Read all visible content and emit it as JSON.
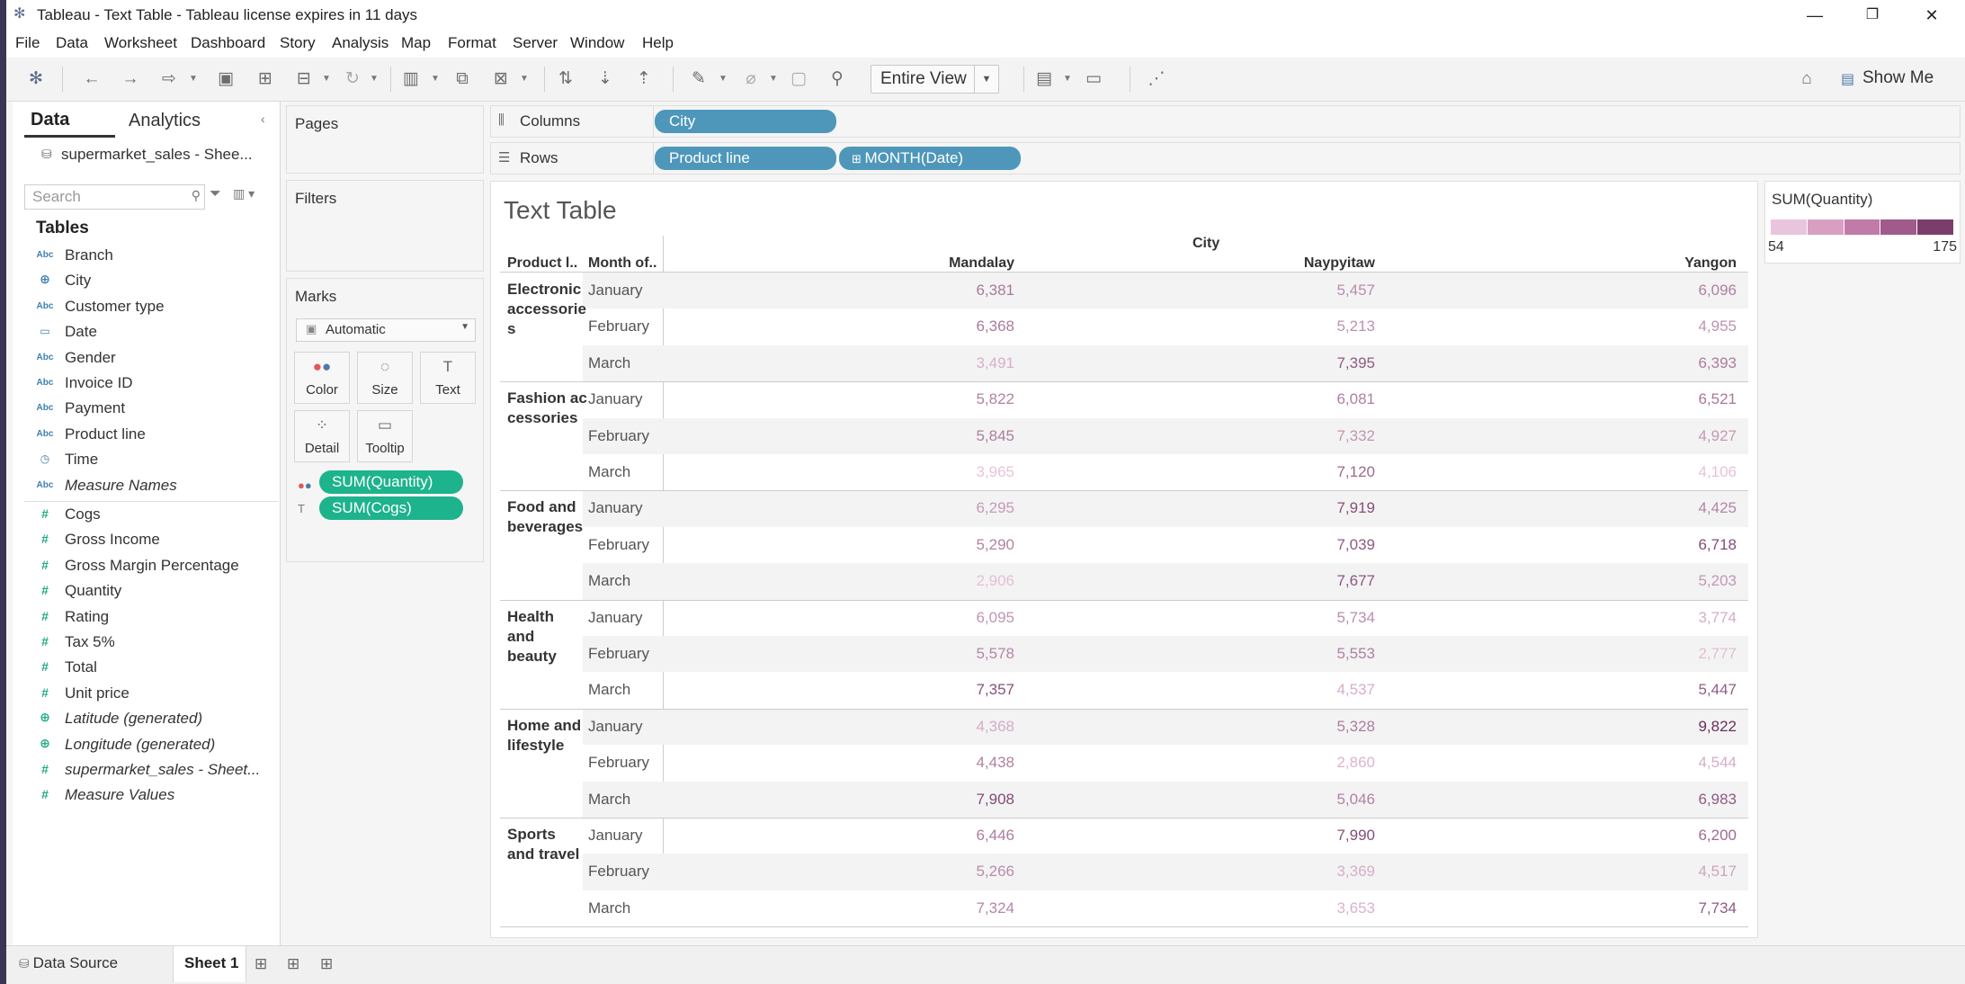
{
  "window": {
    "title": "Tableau - Text Table - Tableau license expires in 11 days",
    "controls": {
      "minimize": "—",
      "maximize": "❐",
      "close": "✕"
    }
  },
  "menu": [
    "File",
    "Data",
    "Worksheet",
    "Dashboard",
    "Story",
    "Analysis",
    "Map",
    "Format",
    "Server",
    "Window",
    "Help"
  ],
  "toolbar": {
    "fit": "Entire View",
    "show_me": "Show Me"
  },
  "data_pane": {
    "tab_data": "Data",
    "tab_analytics": "Analytics",
    "datasource": "supermarket_sales - Shee...",
    "search_placeholder": "Search",
    "tables_title": "Tables",
    "dimensions": [
      {
        "type": "Abc",
        "name": "Branch",
        "italic": false
      },
      {
        "type": "⊕",
        "name": "City",
        "italic": false
      },
      {
        "type": "Abc",
        "name": "Customer type",
        "italic": false
      },
      {
        "type": "▭",
        "name": "Date",
        "italic": false
      },
      {
        "type": "Abc",
        "name": "Gender",
        "italic": false
      },
      {
        "type": "Abc",
        "name": "Invoice ID",
        "italic": false
      },
      {
        "type": "Abc",
        "name": "Payment",
        "italic": false
      },
      {
        "type": "Abc",
        "name": "Product line",
        "italic": false
      },
      {
        "type": "◷",
        "name": "Time",
        "italic": false
      },
      {
        "type": "Abc",
        "name": "Measure Names",
        "italic": true
      }
    ],
    "measures": [
      {
        "type": "#",
        "name": "Cogs",
        "italic": false
      },
      {
        "type": "#",
        "name": "Gross Income",
        "italic": false
      },
      {
        "type": "#",
        "name": "Gross Margin Percentage",
        "italic": false
      },
      {
        "type": "#",
        "name": "Quantity",
        "italic": false
      },
      {
        "type": "#",
        "name": "Rating",
        "italic": false
      },
      {
        "type": "#",
        "name": "Tax 5%",
        "italic": false
      },
      {
        "type": "#",
        "name": "Total",
        "italic": false
      },
      {
        "type": "#",
        "name": "Unit price",
        "italic": false
      },
      {
        "type": "⊕",
        "name": "Latitude (generated)",
        "italic": true
      },
      {
        "type": "⊕",
        "name": "Longitude (generated)",
        "italic": true
      },
      {
        "type": "#",
        "name": "supermarket_sales - Sheet...",
        "italic": true
      },
      {
        "type": "#",
        "name": "Measure Values",
        "italic": true
      }
    ]
  },
  "cards": {
    "pages": "Pages",
    "filters": "Filters",
    "marks": "Marks",
    "marks_type": "Automatic",
    "mark_buttons": [
      {
        "label": "Color",
        "icon": "color-icon"
      },
      {
        "label": "Size",
        "icon": "size-icon"
      },
      {
        "label": "Text",
        "icon": "text-icon"
      },
      {
        "label": "Detail",
        "icon": "detail-icon"
      },
      {
        "label": "Tooltip",
        "icon": "tooltip-icon"
      }
    ],
    "mark_pills": [
      "SUM(Quantity)",
      "SUM(Cogs)"
    ]
  },
  "shelves": {
    "columns_label": "Columns",
    "rows_label": "Rows",
    "columns_pills": [
      "City"
    ],
    "rows_pills": [
      "Product line",
      "MONTH(Date)"
    ]
  },
  "view": {
    "title": "Text Table",
    "city_header": "City",
    "row_header_1": "Product l..",
    "row_header_2": "Month of..",
    "cities": [
      "Mandalay",
      "Naypyitaw",
      "Yangon"
    ],
    "product_lines": [
      "Electronic accessories",
      "Fashion accessories",
      "Food and beverages",
      "Health and beauty",
      "Home and lifestyle",
      "Sports and travel"
    ],
    "product_line_display": [
      "Electronic\naccessorie\ns",
      "Fashion ac\ncessories",
      "Food and\nbeverages",
      "Health\nand\nbeauty",
      "Home and\nlifestyle",
      "Sports\nand travel"
    ],
    "months": [
      "January",
      "February",
      "March"
    ]
  },
  "chart_data": {
    "type": "table",
    "title": "Text Table",
    "columns": [
      "Mandalay",
      "Naypyitaw",
      "Yangon"
    ],
    "text_measure": "SUM(Cogs)",
    "color_measure": "SUM(Quantity)",
    "rows": [
      {
        "product_line": "Electronic accessories",
        "month": "January",
        "cogs": [
          "6,381",
          "5,457",
          "6,096"
        ],
        "quantity": [
          115,
          99,
          110
        ]
      },
      {
        "product_line": "Electronic accessories",
        "month": "February",
        "cogs": [
          "6,368",
          "5,213",
          "4,955"
        ],
        "quantity": [
          114,
          95,
          94
        ]
      },
      {
        "product_line": "Electronic accessories",
        "month": "March",
        "cogs": [
          "3,491",
          "7,395",
          "6,393"
        ],
        "quantity": [
          70,
          140,
          112
        ]
      },
      {
        "product_line": "Fashion accessories",
        "month": "January",
        "cogs": [
          "5,822",
          "6,081",
          "6,521"
        ],
        "quantity": [
          108,
          110,
          116
        ]
      },
      {
        "product_line": "Fashion accessories",
        "month": "February",
        "cogs": [
          "5,845",
          "7,332",
          "4,927"
        ],
        "quantity": [
          111,
          92,
          89
        ]
      },
      {
        "product_line": "Fashion accessories",
        "month": "March",
        "cogs": [
          "3,965",
          "7,120",
          "4,106"
        ],
        "quantity": [
          54,
          128,
          56
        ]
      },
      {
        "product_line": "Food and beverages",
        "month": "January",
        "cogs": [
          "6,295",
          "7,919",
          "4,425"
        ],
        "quantity": [
          88,
          148,
          105
        ]
      },
      {
        "product_line": "Food and beverages",
        "month": "February",
        "cogs": [
          "5,290",
          "7,039",
          "6,718"
        ],
        "quantity": [
          107,
          140,
          151
        ]
      },
      {
        "product_line": "Food and beverages",
        "month": "March",
        "cogs": [
          "2,906",
          "7,677",
          "5,203"
        ],
        "quantity": [
          58,
          143,
          90
        ]
      },
      {
        "product_line": "Health and beauty",
        "month": "January",
        "cogs": [
          "6,095",
          "5,734",
          "3,774"
        ],
        "quantity": [
          92,
          98,
          73
        ]
      },
      {
        "product_line": "Health and beauty",
        "month": "February",
        "cogs": [
          "5,578",
          "5,553",
          "2,777"
        ],
        "quantity": [
          104,
          110,
          60
        ]
      },
      {
        "product_line": "Health and beauty",
        "month": "March",
        "cogs": [
          "7,357",
          "4,537",
          "5,447"
        ],
        "quantity": [
          148,
          72,
          138
        ]
      },
      {
        "product_line": "Home and lifestyle",
        "month": "January",
        "cogs": [
          "4,368",
          "5,328",
          "9,822"
        ],
        "quantity": [
          74,
          112,
          175
        ]
      },
      {
        "product_line": "Home and lifestyle",
        "month": "February",
        "cogs": [
          "4,438",
          "2,860",
          "4,544"
        ],
        "quantity": [
          108,
          66,
          72
        ]
      },
      {
        "product_line": "Home and lifestyle",
        "month": "March",
        "cogs": [
          "7,908",
          "5,046",
          "6,983"
        ],
        "quantity": [
          152,
          108,
          140
        ]
      },
      {
        "product_line": "Sports and travel",
        "month": "January",
        "cogs": [
          "6,446",
          "7,990",
          "6,200"
        ],
        "quantity": [
          112,
          150,
          126
        ]
      },
      {
        "product_line": "Sports and travel",
        "month": "February",
        "cogs": [
          "5,266",
          "3,369",
          "4,517"
        ],
        "quantity": [
          100,
          72,
          80
        ]
      },
      {
        "product_line": "Sports and travel",
        "month": "March",
        "cogs": [
          "7,324",
          "3,653",
          "7,734"
        ],
        "quantity": [
          104,
          68,
          140
        ]
      }
    ],
    "legend": {
      "title": "SUM(Quantity)",
      "min": "54",
      "max": "175",
      "colors": [
        "#e9c5dd",
        "#d7a0c3",
        "#c07ba8",
        "#a05a8c",
        "#7a3e6c"
      ]
    }
  },
  "status_bar": {
    "data_source": "Data Source",
    "sheet": "Sheet 1"
  }
}
